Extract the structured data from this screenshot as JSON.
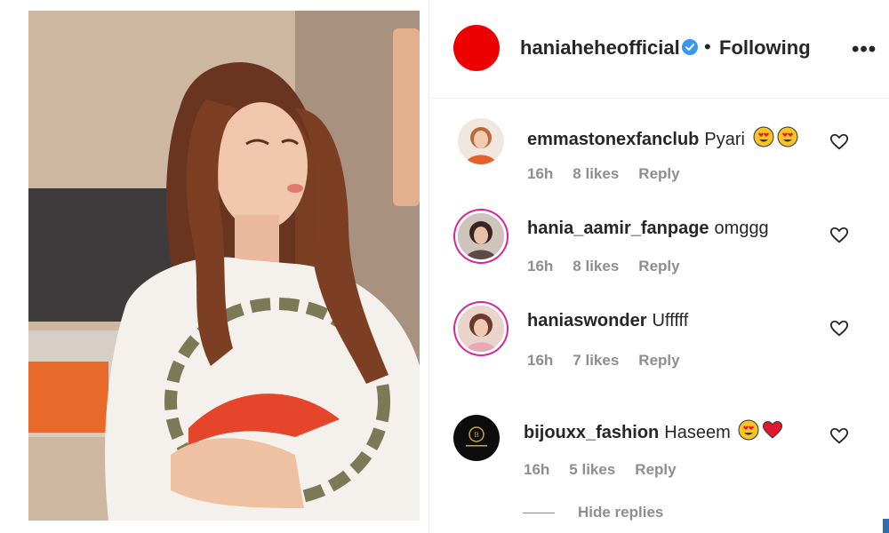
{
  "post": {
    "username": "haniaheheofficial",
    "separator": "•",
    "follow_status": "Following",
    "more_label": "•••",
    "avatar_color": "#ee0000",
    "verified_color": "#3897f0"
  },
  "comments": [
    {
      "username": "emmastonexfanclub",
      "text": "Pyari",
      "emojis": [
        "heart-eyes",
        "heart-eyes"
      ],
      "time": "16h",
      "likes": "8 likes",
      "reply": "Reply"
    },
    {
      "username": "hania_aamir_fanpage",
      "text": "omggg",
      "emojis": [],
      "time": "16h",
      "likes": "8 likes",
      "reply": "Reply"
    },
    {
      "username": "haniaswonder",
      "text": "Ufffff",
      "emojis": [],
      "time": "16h",
      "likes": "7 likes",
      "reply": "Reply"
    },
    {
      "username": "bijouxx_fashion",
      "text": "Haseem",
      "emojis": [
        "heart-eyes",
        "red-heart"
      ],
      "time": "16h",
      "likes": "5 likes",
      "reply": "Reply"
    }
  ],
  "hide_replies": "Hide replies"
}
